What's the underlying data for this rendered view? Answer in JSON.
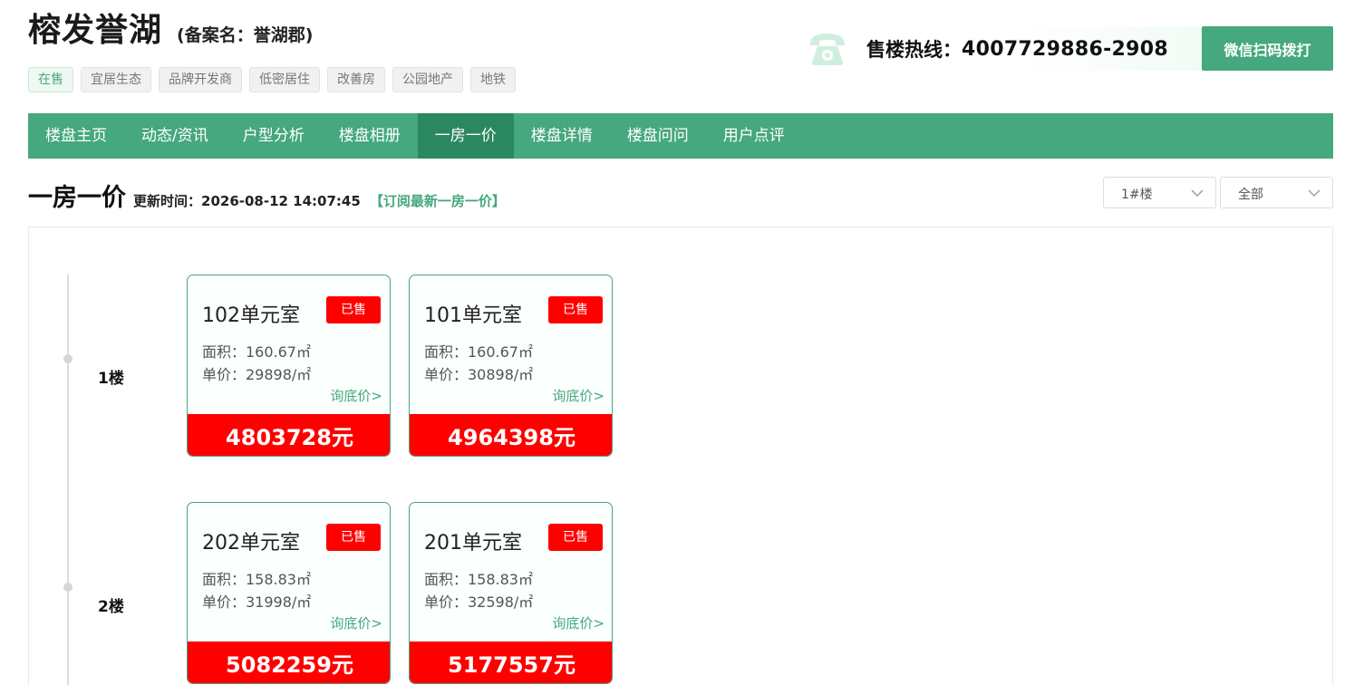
{
  "header": {
    "title": "榕发誉湖",
    "record_name": "(备案名：誉湖郡)",
    "tags": [
      {
        "label": "在售",
        "active": true
      },
      {
        "label": "宜居生态",
        "active": false
      },
      {
        "label": "品牌开发商",
        "active": false
      },
      {
        "label": "低密居住",
        "active": false
      },
      {
        "label": "改善房",
        "active": false
      },
      {
        "label": "公园地产",
        "active": false
      },
      {
        "label": "地铁",
        "active": false
      }
    ],
    "hotline_label": "售楼热线：",
    "hotline_number": "4007729886-2908",
    "wechat_button": "微信扫码拨打"
  },
  "nav": {
    "items": [
      {
        "label": "楼盘主页"
      },
      {
        "label": "动态/资讯"
      },
      {
        "label": "户型分析"
      },
      {
        "label": "楼盘相册"
      },
      {
        "label": "一房一价"
      },
      {
        "label": "楼盘详情"
      },
      {
        "label": "楼盘问问"
      },
      {
        "label": "用户点评"
      }
    ],
    "active_index": 4
  },
  "section": {
    "title": "一房一价",
    "update_label": "更新时间：",
    "update_time": "2026-08-12 14:07:45",
    "subscribe": "【订阅最新一房一价】"
  },
  "filters": {
    "building": "1#楼",
    "scope": "全部"
  },
  "floors": [
    {
      "label": "1楼",
      "units": [
        {
          "room": "102单元室",
          "status": "已售",
          "area": "面积：160.67㎡",
          "unit_price": "单价：29898/㎡",
          "ask": "询底价>",
          "total": "4803728元"
        },
        {
          "room": "101单元室",
          "status": "已售",
          "area": "面积：160.67㎡",
          "unit_price": "单价：30898/㎡",
          "ask": "询底价>",
          "total": "4964398元"
        }
      ]
    },
    {
      "label": "2楼",
      "units": [
        {
          "room": "202单元室",
          "status": "已售",
          "area": "面积：158.83㎡",
          "unit_price": "单价：31998/㎡",
          "ask": "询底价>",
          "total": "5082259元"
        },
        {
          "room": "201单元室",
          "status": "已售",
          "area": "面积：158.83㎡",
          "unit_price": "单价：32598/㎡",
          "ask": "询底价>",
          "total": "5177557元"
        }
      ]
    }
  ],
  "colors": {
    "brand": "#45a87e",
    "brand_dark": "#2b8760",
    "sold": "#ff0000"
  }
}
